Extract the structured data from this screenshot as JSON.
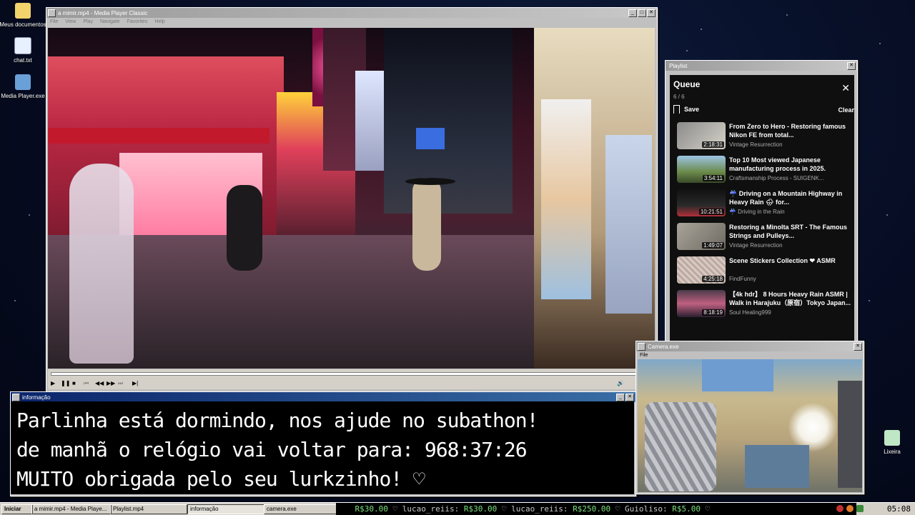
{
  "desktop_icons": [
    {
      "label": "Meus documentos"
    },
    {
      "label": "chat.txt"
    },
    {
      "label": "Media Player.exe"
    },
    {
      "label": "Lixeira"
    }
  ],
  "player": {
    "title": "a mimir.mp4 - Media Player Classic",
    "menu": [
      "File",
      "View",
      "Play",
      "Navigate",
      "Favorites",
      "Help"
    ]
  },
  "info_window": {
    "title": "informação",
    "lines": [
      "Parlinha está dormindo, nos ajude no subathon!",
      "de manhã o relógio vai voltar para:  968:37:26",
      "MUITO obrigada pelo seu lurkzinho! ♡"
    ]
  },
  "playlist": {
    "window_title": "Playlist",
    "heading": "Queue",
    "count": "6 / 6",
    "save_label": "Save",
    "clear_label": "Clear",
    "items": [
      {
        "title": "From Zero to Hero - Restoring famous Nikon FE from total...",
        "channel": "Vintage Resurrection",
        "duration": "2:18:31"
      },
      {
        "title": "Top 10 Most viewed Japanese manufacturing process in 2025.",
        "channel": "Craftsmanship Process - SUIGENK...",
        "duration": "3:54:11"
      },
      {
        "title": "☔ Driving on a Mountain Highway in Heavy Rain 🌧 for...",
        "channel": "☔ Driving in the Rain",
        "duration": "10:21:51"
      },
      {
        "title": "Restoring a Minolta SRT - The Famous Strings and Pulleys...",
        "channel": "Vintage Resurrection",
        "duration": "1:49:07"
      },
      {
        "title": "Scene Stickers Collection ❤ ASMR",
        "channel": "FindFunny",
        "duration": "4:25:18"
      },
      {
        "title": "【4k hdr】 8 Hours Heavy Rain ASMR | Walk in Harajuku（原宿）Tokyo Japan...",
        "channel": "Soul Healing999",
        "duration": "8:18:19"
      }
    ]
  },
  "camera": {
    "title": "Camera.exe",
    "menu": "File"
  },
  "taskbar": {
    "start": "Iniciar",
    "items": [
      "a mimir.mp4 - Media Playe...",
      "Playlist.mp4",
      "informação",
      "camera.exe"
    ],
    "ticker": [
      {
        "amount": "R$30.00",
        "sep": "♡",
        "user": "lucao_reiis:"
      },
      {
        "amount": "R$30.00",
        "sep": "♡",
        "user": "lucao_reiis:"
      },
      {
        "amount": "R$250.00",
        "sep": "♡",
        "user": "Guioliso:"
      },
      {
        "amount": "R$5.00",
        "sep": "♡",
        "user": ""
      }
    ],
    "clock": "05:08"
  },
  "colors": {
    "titlebar_active": "#0a246a",
    "ticker_money": "#7de07d"
  }
}
